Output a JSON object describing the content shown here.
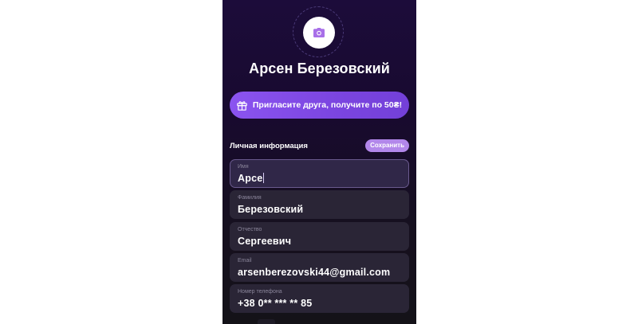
{
  "profile": {
    "name": "Арсен Березовский"
  },
  "invite": {
    "label": "Пригласите друга, получите по 50₴!"
  },
  "personal_info": {
    "title": "Личная информация",
    "save_label": "Сохранить"
  },
  "fields": [
    {
      "label": "Имя",
      "value": "Арсе"
    },
    {
      "label": "Фамилия",
      "value": "Березовский"
    },
    {
      "label": "Отчество",
      "value": "Сергеевич"
    },
    {
      "label": "Email",
      "value": "arsenberezovski44@gmail.com"
    },
    {
      "label": "Номер телефона",
      "value": "+38 0** *** ** 85"
    }
  ],
  "colors": {
    "accent": "#8b54f0",
    "save_button": "#b287ea",
    "field_bg": "#2a2536",
    "background": "#1c0c3a"
  },
  "icons": {
    "avatar": "camera-icon",
    "invite": "gift-icon"
  }
}
